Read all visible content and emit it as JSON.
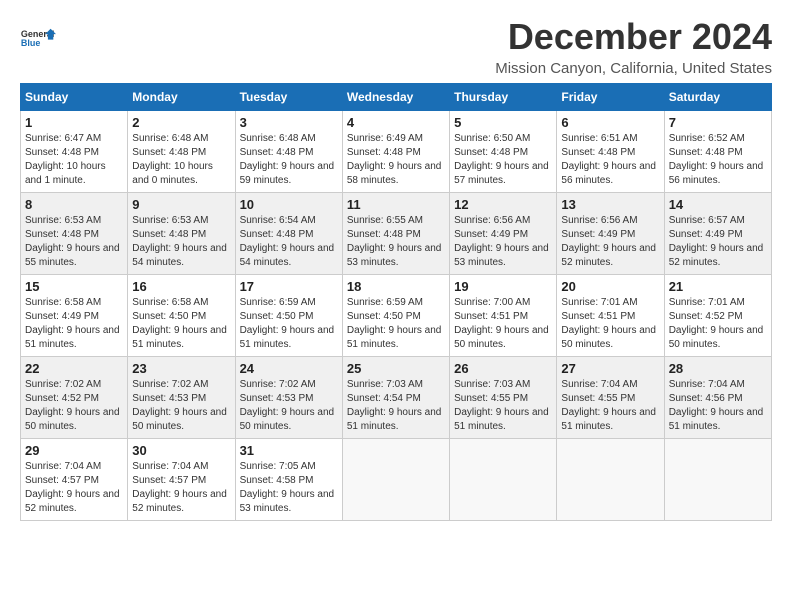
{
  "logo": {
    "line1": "General",
    "line2": "Blue"
  },
  "title": "December 2024",
  "location": "Mission Canyon, California, United States",
  "weekdays": [
    "Sunday",
    "Monday",
    "Tuesday",
    "Wednesday",
    "Thursday",
    "Friday",
    "Saturday"
  ],
  "weeks": [
    [
      {
        "day": "1",
        "sunrise": "Sunrise: 6:47 AM",
        "sunset": "Sunset: 4:48 PM",
        "daylight": "Daylight: 10 hours and 1 minute."
      },
      {
        "day": "2",
        "sunrise": "Sunrise: 6:48 AM",
        "sunset": "Sunset: 4:48 PM",
        "daylight": "Daylight: 10 hours and 0 minutes."
      },
      {
        "day": "3",
        "sunrise": "Sunrise: 6:48 AM",
        "sunset": "Sunset: 4:48 PM",
        "daylight": "Daylight: 9 hours and 59 minutes."
      },
      {
        "day": "4",
        "sunrise": "Sunrise: 6:49 AM",
        "sunset": "Sunset: 4:48 PM",
        "daylight": "Daylight: 9 hours and 58 minutes."
      },
      {
        "day": "5",
        "sunrise": "Sunrise: 6:50 AM",
        "sunset": "Sunset: 4:48 PM",
        "daylight": "Daylight: 9 hours and 57 minutes."
      },
      {
        "day": "6",
        "sunrise": "Sunrise: 6:51 AM",
        "sunset": "Sunset: 4:48 PM",
        "daylight": "Daylight: 9 hours and 56 minutes."
      },
      {
        "day": "7",
        "sunrise": "Sunrise: 6:52 AM",
        "sunset": "Sunset: 4:48 PM",
        "daylight": "Daylight: 9 hours and 56 minutes."
      }
    ],
    [
      {
        "day": "8",
        "sunrise": "Sunrise: 6:53 AM",
        "sunset": "Sunset: 4:48 PM",
        "daylight": "Daylight: 9 hours and 55 minutes."
      },
      {
        "day": "9",
        "sunrise": "Sunrise: 6:53 AM",
        "sunset": "Sunset: 4:48 PM",
        "daylight": "Daylight: 9 hours and 54 minutes."
      },
      {
        "day": "10",
        "sunrise": "Sunrise: 6:54 AM",
        "sunset": "Sunset: 4:48 PM",
        "daylight": "Daylight: 9 hours and 54 minutes."
      },
      {
        "day": "11",
        "sunrise": "Sunrise: 6:55 AM",
        "sunset": "Sunset: 4:48 PM",
        "daylight": "Daylight: 9 hours and 53 minutes."
      },
      {
        "day": "12",
        "sunrise": "Sunrise: 6:56 AM",
        "sunset": "Sunset: 4:49 PM",
        "daylight": "Daylight: 9 hours and 53 minutes."
      },
      {
        "day": "13",
        "sunrise": "Sunrise: 6:56 AM",
        "sunset": "Sunset: 4:49 PM",
        "daylight": "Daylight: 9 hours and 52 minutes."
      },
      {
        "day": "14",
        "sunrise": "Sunrise: 6:57 AM",
        "sunset": "Sunset: 4:49 PM",
        "daylight": "Daylight: 9 hours and 52 minutes."
      }
    ],
    [
      {
        "day": "15",
        "sunrise": "Sunrise: 6:58 AM",
        "sunset": "Sunset: 4:49 PM",
        "daylight": "Daylight: 9 hours and 51 minutes."
      },
      {
        "day": "16",
        "sunrise": "Sunrise: 6:58 AM",
        "sunset": "Sunset: 4:50 PM",
        "daylight": "Daylight: 9 hours and 51 minutes."
      },
      {
        "day": "17",
        "sunrise": "Sunrise: 6:59 AM",
        "sunset": "Sunset: 4:50 PM",
        "daylight": "Daylight: 9 hours and 51 minutes."
      },
      {
        "day": "18",
        "sunrise": "Sunrise: 6:59 AM",
        "sunset": "Sunset: 4:50 PM",
        "daylight": "Daylight: 9 hours and 51 minutes."
      },
      {
        "day": "19",
        "sunrise": "Sunrise: 7:00 AM",
        "sunset": "Sunset: 4:51 PM",
        "daylight": "Daylight: 9 hours and 50 minutes."
      },
      {
        "day": "20",
        "sunrise": "Sunrise: 7:01 AM",
        "sunset": "Sunset: 4:51 PM",
        "daylight": "Daylight: 9 hours and 50 minutes."
      },
      {
        "day": "21",
        "sunrise": "Sunrise: 7:01 AM",
        "sunset": "Sunset: 4:52 PM",
        "daylight": "Daylight: 9 hours and 50 minutes."
      }
    ],
    [
      {
        "day": "22",
        "sunrise": "Sunrise: 7:02 AM",
        "sunset": "Sunset: 4:52 PM",
        "daylight": "Daylight: 9 hours and 50 minutes."
      },
      {
        "day": "23",
        "sunrise": "Sunrise: 7:02 AM",
        "sunset": "Sunset: 4:53 PM",
        "daylight": "Daylight: 9 hours and 50 minutes."
      },
      {
        "day": "24",
        "sunrise": "Sunrise: 7:02 AM",
        "sunset": "Sunset: 4:53 PM",
        "daylight": "Daylight: 9 hours and 50 minutes."
      },
      {
        "day": "25",
        "sunrise": "Sunrise: 7:03 AM",
        "sunset": "Sunset: 4:54 PM",
        "daylight": "Daylight: 9 hours and 51 minutes."
      },
      {
        "day": "26",
        "sunrise": "Sunrise: 7:03 AM",
        "sunset": "Sunset: 4:55 PM",
        "daylight": "Daylight: 9 hours and 51 minutes."
      },
      {
        "day": "27",
        "sunrise": "Sunrise: 7:04 AM",
        "sunset": "Sunset: 4:55 PM",
        "daylight": "Daylight: 9 hours and 51 minutes."
      },
      {
        "day": "28",
        "sunrise": "Sunrise: 7:04 AM",
        "sunset": "Sunset: 4:56 PM",
        "daylight": "Daylight: 9 hours and 51 minutes."
      }
    ],
    [
      {
        "day": "29",
        "sunrise": "Sunrise: 7:04 AM",
        "sunset": "Sunset: 4:57 PM",
        "daylight": "Daylight: 9 hours and 52 minutes."
      },
      {
        "day": "30",
        "sunrise": "Sunrise: 7:04 AM",
        "sunset": "Sunset: 4:57 PM",
        "daylight": "Daylight: 9 hours and 52 minutes."
      },
      {
        "day": "31",
        "sunrise": "Sunrise: 7:05 AM",
        "sunset": "Sunset: 4:58 PM",
        "daylight": "Daylight: 9 hours and 53 minutes."
      },
      null,
      null,
      null,
      null
    ]
  ]
}
